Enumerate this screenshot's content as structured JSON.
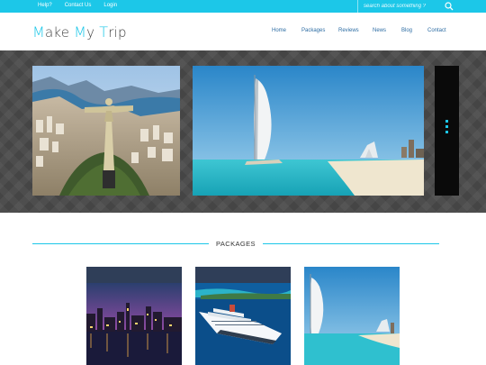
{
  "topbar": {
    "links": [
      "Help?",
      "Contact Us",
      "Login"
    ],
    "search_placeholder": "search about something ?"
  },
  "header": {
    "logo": {
      "w1_cap": "M",
      "w1_rest": "ake ",
      "w2_cap": "M",
      "w2_rest": "y ",
      "w3_cap": "T",
      "w3_rest": "rip"
    },
    "nav": [
      "Home",
      "Packages",
      "Reviews",
      "News",
      "Blog",
      "Contact"
    ]
  },
  "slider": {
    "slides": [
      "rio-christ-redeemer",
      "dubai-burj-al-arab",
      "dark-slide"
    ]
  },
  "packages": {
    "title": "PACKAGES",
    "cards": [
      "city-night-skyline",
      "cruise-ship",
      "dubai-burj-al-arab"
    ]
  },
  "colors": {
    "accent": "#1cc7e8",
    "nav_text": "#2c6ca3",
    "slider_bg": "#4a4a4a"
  }
}
